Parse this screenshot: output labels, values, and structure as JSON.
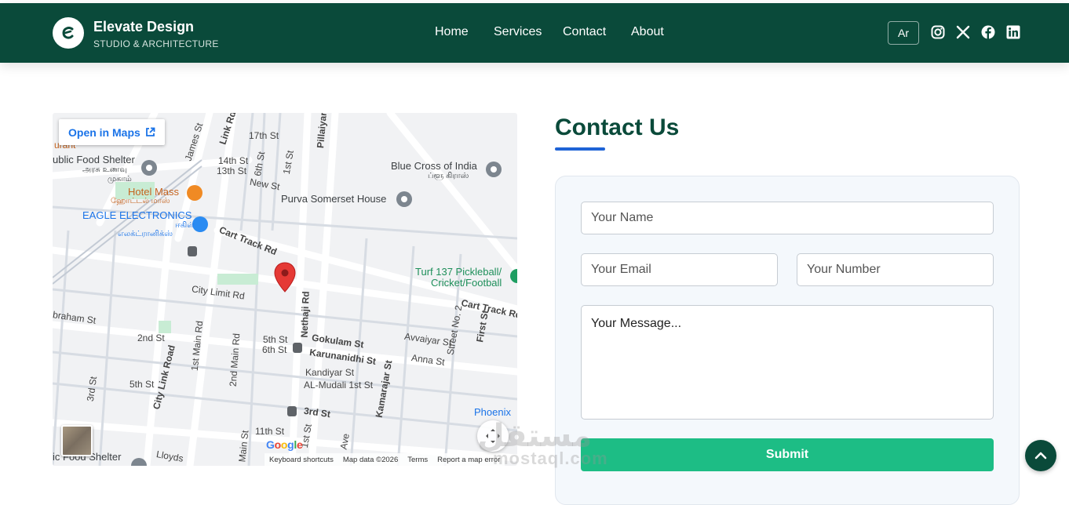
{
  "brand": {
    "name": "Elevate Design",
    "tagline": "STUDIO & ARCHITECTURE",
    "logo_icon": "leaf-e-logo-icon"
  },
  "nav": {
    "items": [
      {
        "label": "Home"
      },
      {
        "label": "Services"
      },
      {
        "label": "Contact"
      },
      {
        "label": "About"
      }
    ]
  },
  "header_actions": {
    "language_label": "Ar",
    "social_icons": [
      "instagram-icon",
      "x-icon",
      "facebook-icon",
      "linkedin-icon"
    ]
  },
  "map": {
    "open_in_maps_label": "Open in Maps",
    "places": [
      "urant",
      "ublic Food Shelter",
      "அரசு உணவு",
      "முகாம்",
      "Hotel Mass",
      "ஹோட்டல் மாஸ்",
      "EAGLE ELECTRONICS",
      "ஈகிள்",
      "எலக்ட்ரானிக்ஸ்",
      "Blue Cross of India",
      "ப்ளூ கிராஸ்",
      "Purva Somerset House",
      "Turf 137 Pickleball/",
      "Cricket/Football",
      "Phoenix",
      "ic Food Shelter"
    ],
    "roads": [
      "Link Rd",
      "James St",
      "17th St",
      "14th St",
      "13th St",
      "6th St",
      "1st St",
      "Pillaiyar",
      "New St",
      "Cart Track Rd",
      "City Limit Rd",
      "Nethaji Rd",
      "Cart Track Rd",
      "braham St",
      "2nd St",
      "1st Main Rd",
      "2nd Main Rd",
      "5th St",
      "6th St",
      "Gokulam St",
      "Karunanidhi St",
      "Avvaiyar St",
      "Street No. 2",
      "First St",
      "Anna St",
      "Kandiyar St",
      "AL-Mudali 1st St",
      "Kamarajar St",
      "City Link Road",
      "3rd St",
      "5th St",
      "11th St",
      "1st St",
      "Ave",
      "Lloyds",
      "Main St",
      "3rd St"
    ],
    "google_logo": "Google",
    "footer_links": [
      "Keyboard shortcuts",
      "Map data ©2026",
      "Terms",
      "Report a map error"
    ]
  },
  "contact": {
    "title": "Contact Us",
    "name_placeholder": "Your Name",
    "email_placeholder": "Your Email",
    "number_placeholder": "Your Number",
    "message_placeholder": "Your Message...",
    "submit_label": "Submit"
  },
  "watermark": {
    "arabic": "مستقل",
    "latin": "mostaql.com"
  },
  "colors": {
    "header_bg": "#0a4a3a",
    "accent_green": "#1dbd85",
    "title_underline": "#1e63d6",
    "map_pin": "#e53935"
  }
}
